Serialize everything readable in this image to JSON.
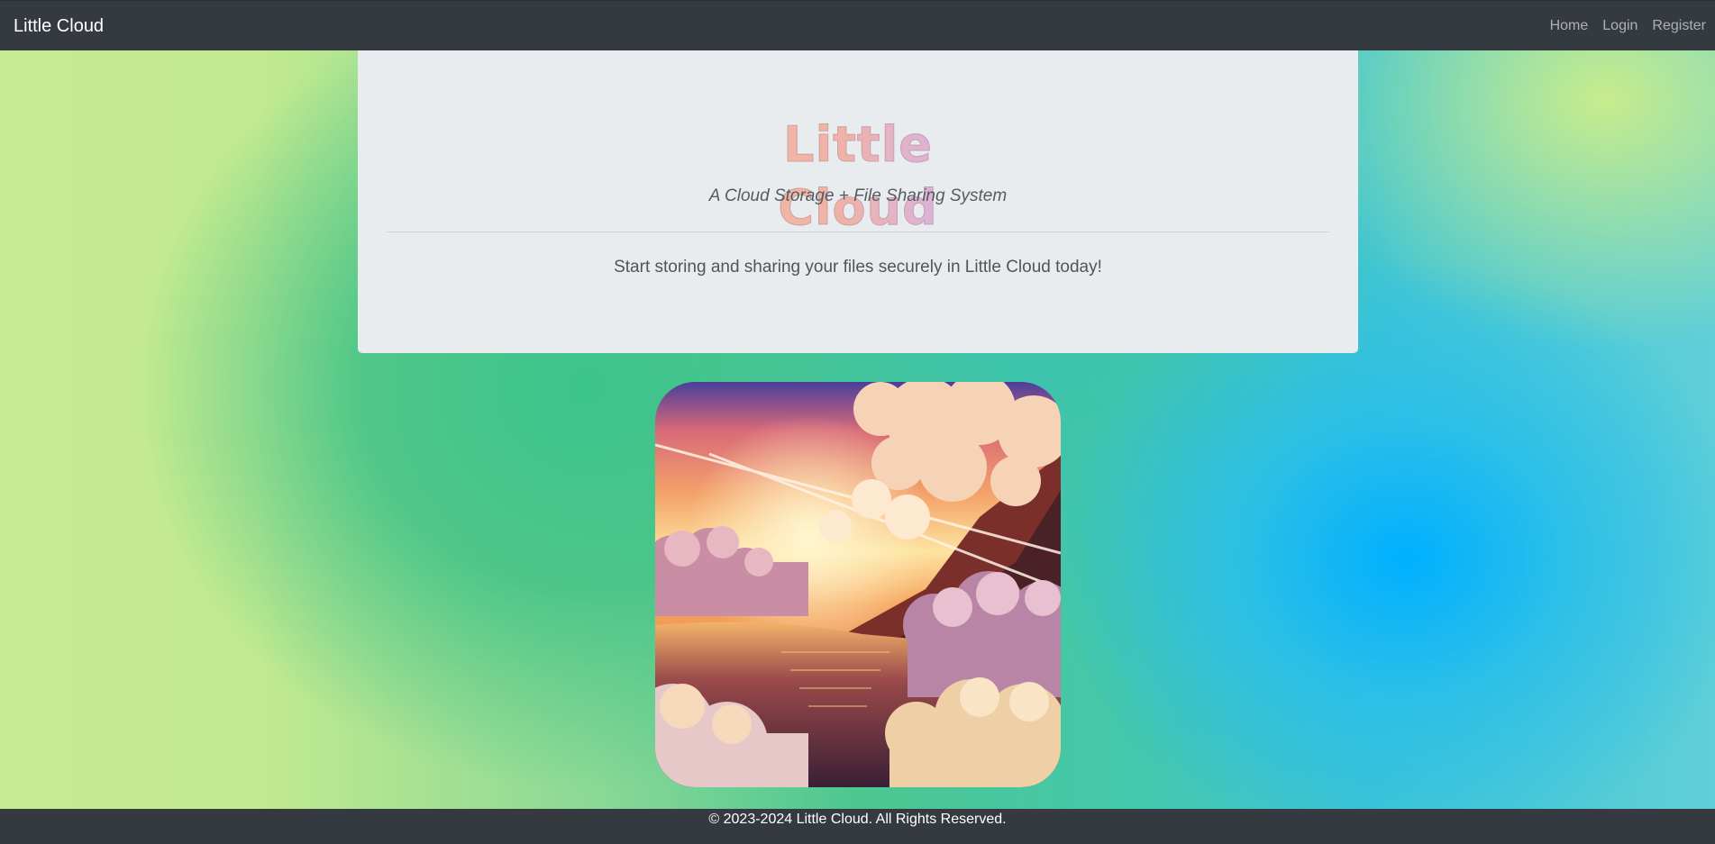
{
  "navbar": {
    "brand": "Little Cloud",
    "links": [
      "Home",
      "Login",
      "Register"
    ]
  },
  "jumbotron": {
    "title": "Little Cloud",
    "subtitle": "A Cloud Storage + File Sharing System",
    "lead": "Start storing and sharing your files securely in Little Cloud today!"
  },
  "hero_image": {
    "description_icon": "sunset-clouds-illustration"
  },
  "footer": {
    "text": "© 2023-2024 Little Cloud. All Rights Reserved."
  },
  "colors": {
    "navbar_bg": "#343a40",
    "jumbotron_bg": "#e9ecef",
    "footer_bg": "#343a40"
  }
}
